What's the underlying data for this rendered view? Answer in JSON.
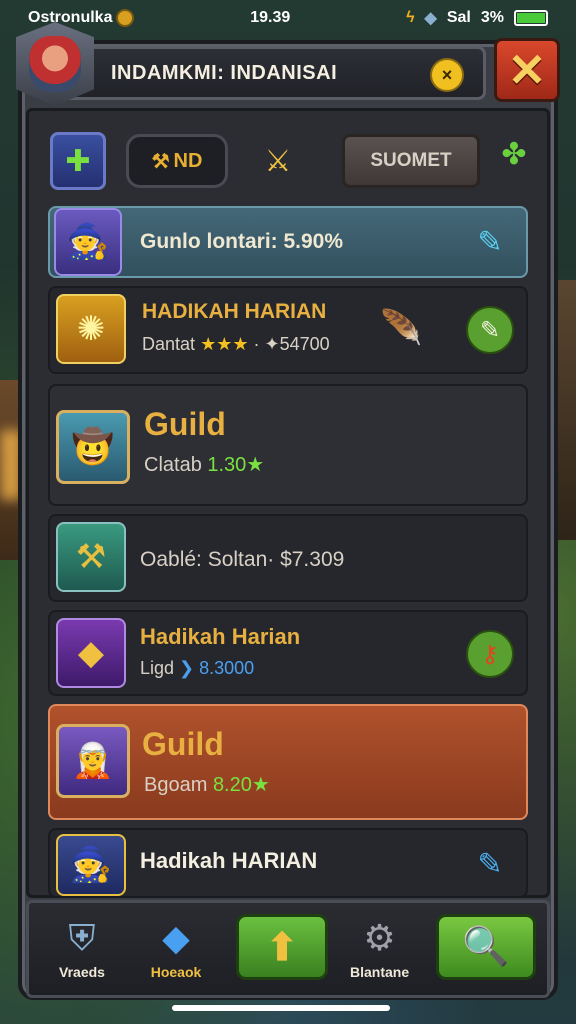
{
  "status_bar": {
    "app_name": "Ostronulka",
    "time": "19.39",
    "signal": "Sal",
    "battery": "3%"
  },
  "header": {
    "title": "INDAMKMI: INDANISAI",
    "badge": "×",
    "close": "✕"
  },
  "tabs": [
    {
      "name": "tab-guild-gem",
      "label": ""
    },
    {
      "name": "tab-nd",
      "label": "ND"
    },
    {
      "name": "tab-sword",
      "label": ""
    },
    {
      "name": "tab-submit",
      "label": "SUOMET"
    },
    {
      "name": "tab-extra",
      "label": ""
    }
  ],
  "rows": [
    {
      "title": "Gunlo lontari: 5.90%",
      "sub": "",
      "highlight": "blue"
    },
    {
      "title": "HADIKAH HARIAN",
      "sub_prefix": "Dantat",
      "stars": "★★★",
      "sub_suffix": "· ✦54700"
    },
    {
      "title": "Guild",
      "sub_prefix": "Clatab",
      "sub_value": "1.30★"
    },
    {
      "title": "",
      "sub": "Oablé: Soltan· $7.309"
    },
    {
      "title": "Hadikah Harian",
      "sub_prefix": "Ligd",
      "sub_value": "❯ 8.3000"
    },
    {
      "title": "Guild",
      "sub_prefix": "Bgoam",
      "sub_value": "8.20★",
      "highlight": "orange"
    },
    {
      "title": "Hadikah HARIAN",
      "sub": ""
    }
  ],
  "bottom_nav": [
    {
      "label": "Vraeds"
    },
    {
      "label": "Hoeaok"
    },
    {
      "label": ""
    },
    {
      "label": "Blantane"
    },
    {
      "label": ""
    }
  ],
  "colors": {
    "accent_gold": "#e8b040",
    "highlight_orange": "#b0522c",
    "highlight_blue": "#446878",
    "green_button": "#5ab030",
    "close_red": "#d9482c"
  }
}
